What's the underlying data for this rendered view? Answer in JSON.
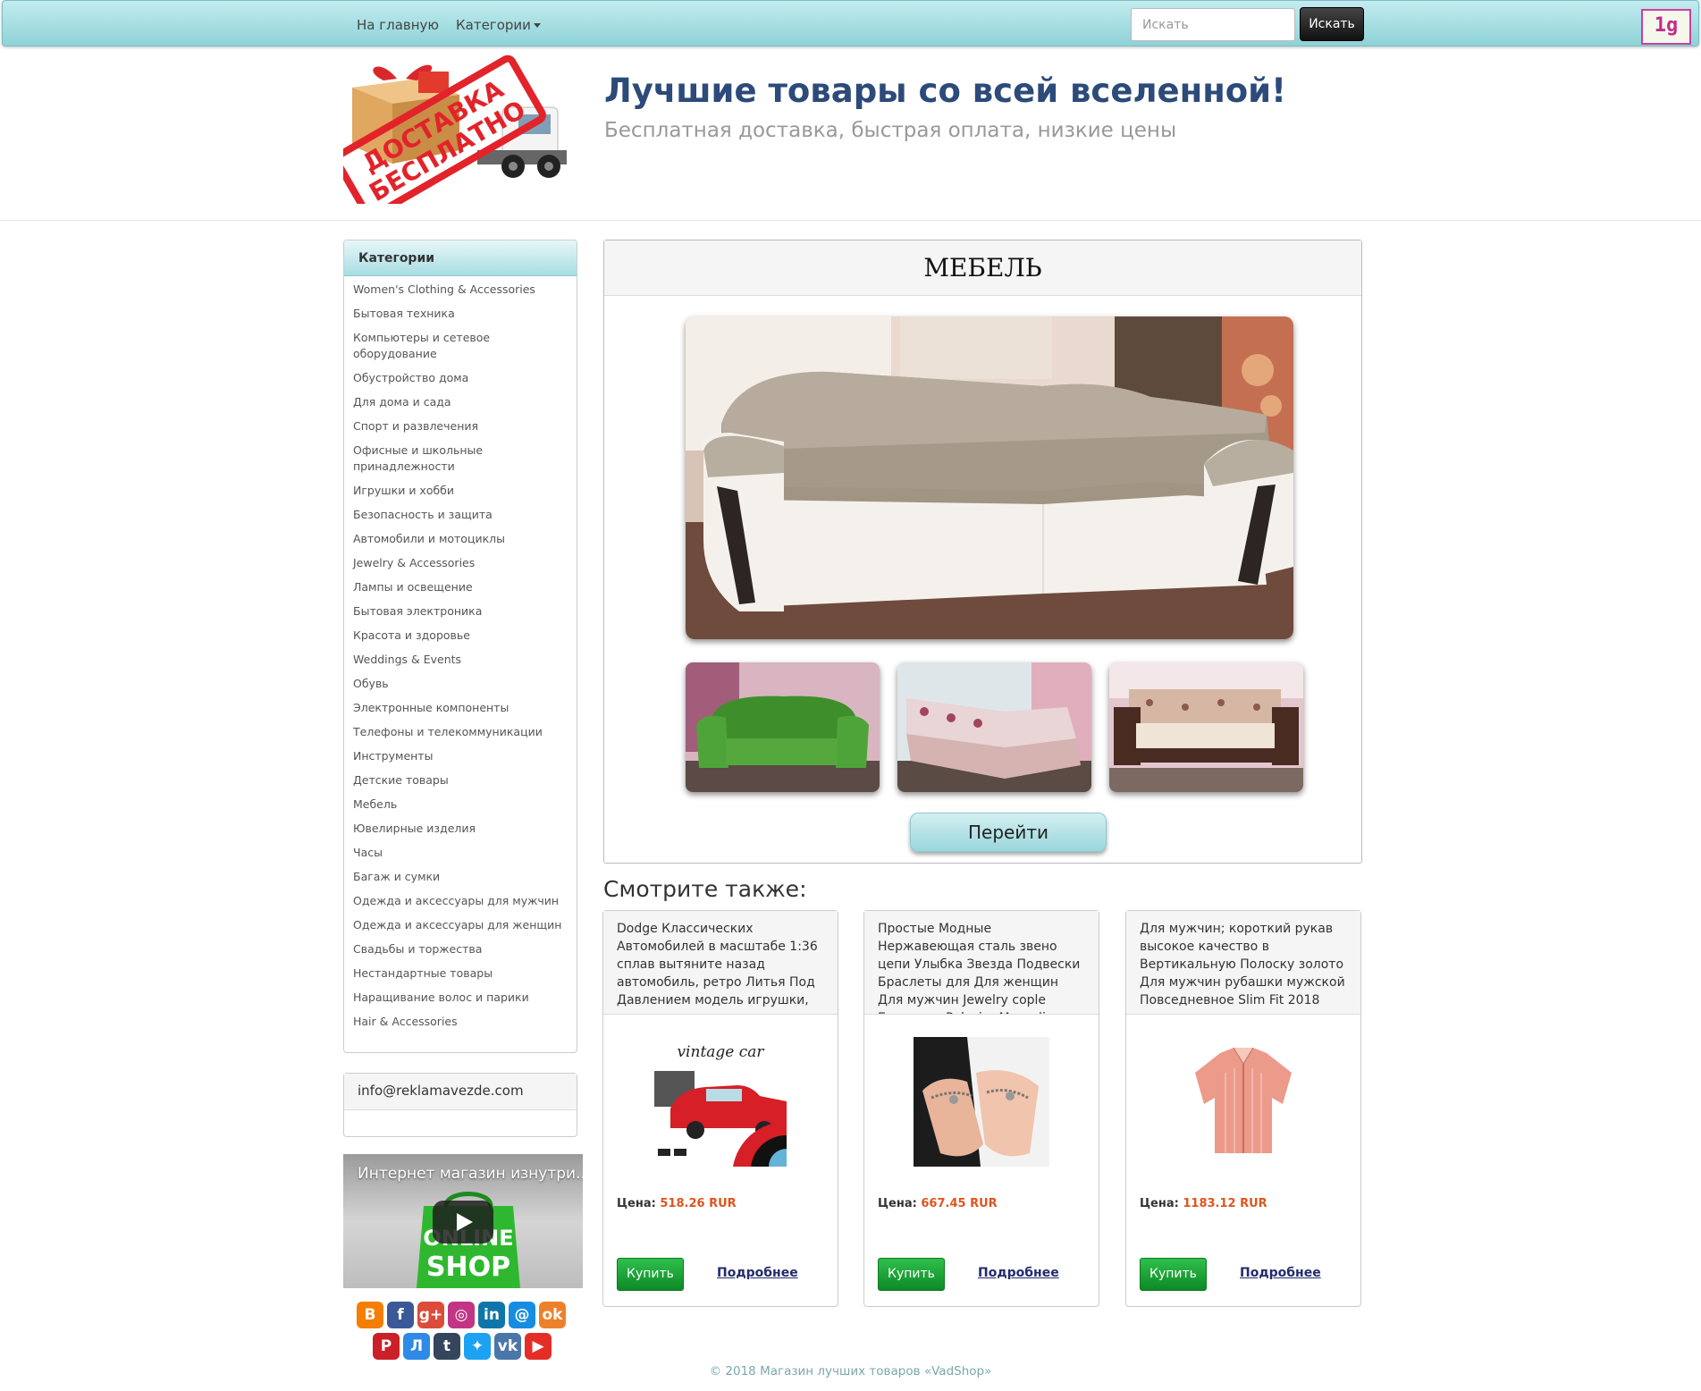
{
  "nav": {
    "home": "На главную",
    "categories": "Категории",
    "search_placeholder": "Искать",
    "search_button": "Искать",
    "badge": "1g"
  },
  "header": {
    "logo_text_1": "ДОСТАВКА",
    "logo_text_2": "БЕСПЛАТНО",
    "title": "Лучшие товары со всей вселенной!",
    "subtitle": "Бесплатная доставка, быстрая оплата, низкие цены"
  },
  "sidebar": {
    "categories_title": "Категории",
    "categories": [
      "Women's Clothing & Accessories",
      "Бытовая техника",
      "Компьютеры и сетевое оборудование",
      "Обустройство дома",
      "Для дома и сада",
      "Спорт и развлечения",
      "Офисные и школьные принадлежности",
      "Игрушки и хобби",
      "Безопасность и защита",
      "Автомобили и мотоциклы",
      "Jewelry & Accessories",
      "Лампы и освещение",
      "Бытовая электроника",
      "Красота и здоровье",
      "Weddings & Events",
      "Обувь",
      "Электронные компоненты",
      "Телефоны и телекоммуникации",
      "Инструменты",
      "Детские товары",
      "Мебель",
      "Ювелирные изделия",
      "Часы",
      "Багаж и сумки",
      "Одежда и аксессуары для мужчин",
      "Одежда и аксессуары для женщин",
      "Свадьбы и торжества",
      "Нестандартные товары",
      "Наращивание волос и парики",
      "Hair & Accessories"
    ],
    "email": "info@reklamavezde.com",
    "video_title": "Интернет магазин изнутри...",
    "video_bag_text_1": "ONLINE",
    "video_bag_text_2": "SHOP",
    "social": [
      {
        "icon": "blogger-icon",
        "glyph": "B",
        "color": "#f57d00"
      },
      {
        "icon": "facebook-icon",
        "glyph": "f",
        "color": "#3b5998"
      },
      {
        "icon": "google-plus-icon",
        "glyph": "g+",
        "color": "#dd4b39"
      },
      {
        "icon": "instagram-icon",
        "glyph": "◎",
        "color": "#c13584"
      },
      {
        "icon": "linkedin-icon",
        "glyph": "in",
        "color": "#0e76a8"
      },
      {
        "icon": "moi-mir-icon",
        "glyph": "@",
        "color": "#168de2"
      },
      {
        "icon": "odnoklassniki-icon",
        "glyph": "ok",
        "color": "#ed812b"
      },
      {
        "icon": "pinterest-icon",
        "glyph": "P",
        "color": "#cb2027"
      },
      {
        "icon": "livejournal-icon",
        "glyph": "Л",
        "color": "#2e8ae6"
      },
      {
        "icon": "tumblr-icon",
        "glyph": "t",
        "color": "#35465c"
      },
      {
        "icon": "twitter-icon",
        "glyph": "✦",
        "color": "#1da1f2"
      },
      {
        "icon": "vk-icon",
        "glyph": "vk",
        "color": "#4a76a8"
      },
      {
        "icon": "youtube-icon",
        "glyph": "▶",
        "color": "#e52d27"
      }
    ]
  },
  "main": {
    "category_title": "МЕБЕЛЬ",
    "go_button": "Перейти"
  },
  "see_also": {
    "title": "Смотрите также:",
    "price_label": "Цена:",
    "buy_label": "Купить",
    "more_label": "Подробнее",
    "vintage_label": "vintage car",
    "products": [
      {
        "title": "Dodge Классических Автомобилей в масштабе 1:36 сплав вытяните назад автомобиль, ретро Литья Под Давлением модель игрушки,",
        "price": "518.26 RUR"
      },
      {
        "title": "Простые Модные Нержавеющая сталь звено цепи Улыбка Звезда Подвески Браслеты для Для женщин Для мужчин Jewelry cople Браслеты Pulseira Masculina",
        "price": "667.45 RUR"
      },
      {
        "title": "Для мужчин; короткий рукав высокое качество в Вертикальную Полоску золото Для мужчин рубашки мужской Повседневное Slim Fit 2018",
        "price": "1183.12 RUR"
      }
    ]
  },
  "footer": "© 2018 Магазин лучших товаров «VadShop»"
}
